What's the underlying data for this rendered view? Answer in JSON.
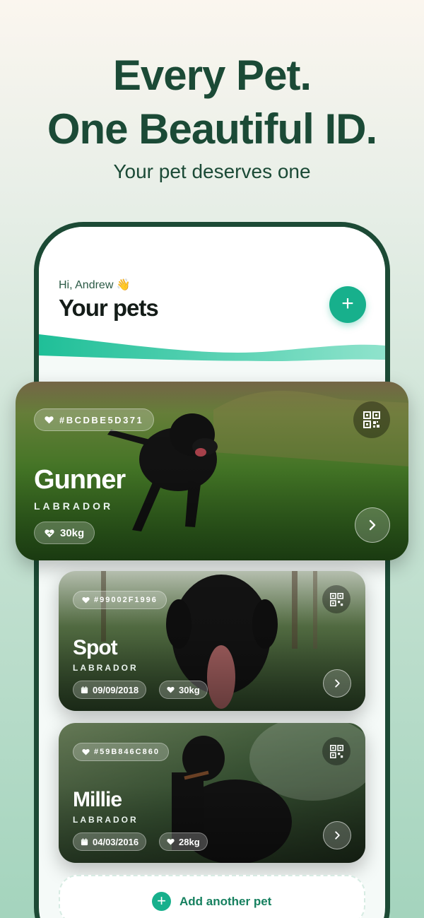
{
  "hero": {
    "line1": "Every Pet.",
    "line2": "One Beautiful ID.",
    "subtitle": "Your pet deserves one"
  },
  "app": {
    "greeting": "Hi, Andrew 👋",
    "title": "Your pets",
    "add_button": "+",
    "add_another_label": "Add another pet"
  },
  "pets": [
    {
      "id": "#BCDBE5D371",
      "name": "Gunner",
      "breed": "LABRADOR",
      "weight": "30kg"
    },
    {
      "id": "#99002F1996",
      "name": "Spot",
      "breed": "LABRADOR",
      "dob": "09/09/2018",
      "weight": "30kg"
    },
    {
      "id": "#59B846C860",
      "name": "Millie",
      "breed": "LABRADOR",
      "dob": "04/03/2016",
      "weight": "28kg"
    }
  ],
  "colors": {
    "brand_dark": "#1b4a36",
    "accent": "#17b08c",
    "add_text": "#16805f"
  },
  "icons": [
    "heart-icon",
    "qr-code-icon",
    "chevron-right-icon",
    "calendar-icon",
    "weight-icon",
    "plus-icon"
  ]
}
